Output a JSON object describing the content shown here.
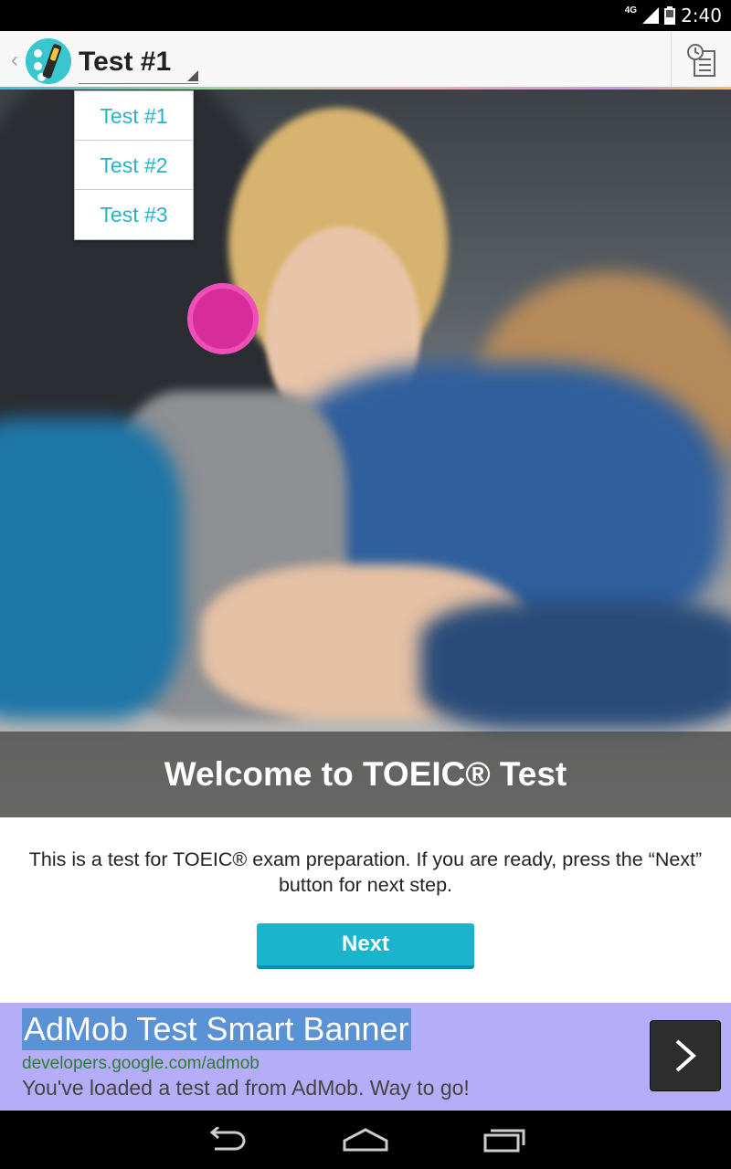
{
  "status_bar": {
    "network": "4G",
    "time": "2:40"
  },
  "action_bar": {
    "selected_test": "Test #1",
    "icons": {
      "back": "chevron-left-icon",
      "app": "app-logo-icon",
      "history": "history-list-icon"
    }
  },
  "dropdown": {
    "items": [
      "Test #1",
      "Test #2",
      "Test #3"
    ]
  },
  "hero": {
    "caption": "Welcome to TOEIC® Test"
  },
  "content": {
    "intro": "This is a  test for TOEIC® exam preparation. If you are ready, press the “Next” button for next step.",
    "next_label": "Next"
  },
  "ad": {
    "title": "AdMob Test Smart Banner",
    "url": "developers.google.com/admob",
    "description": "You've loaded a test ad from AdMob. Way to go!"
  },
  "colors": {
    "accent": "#1ab5cd",
    "ad_background": "#b5adf8"
  }
}
